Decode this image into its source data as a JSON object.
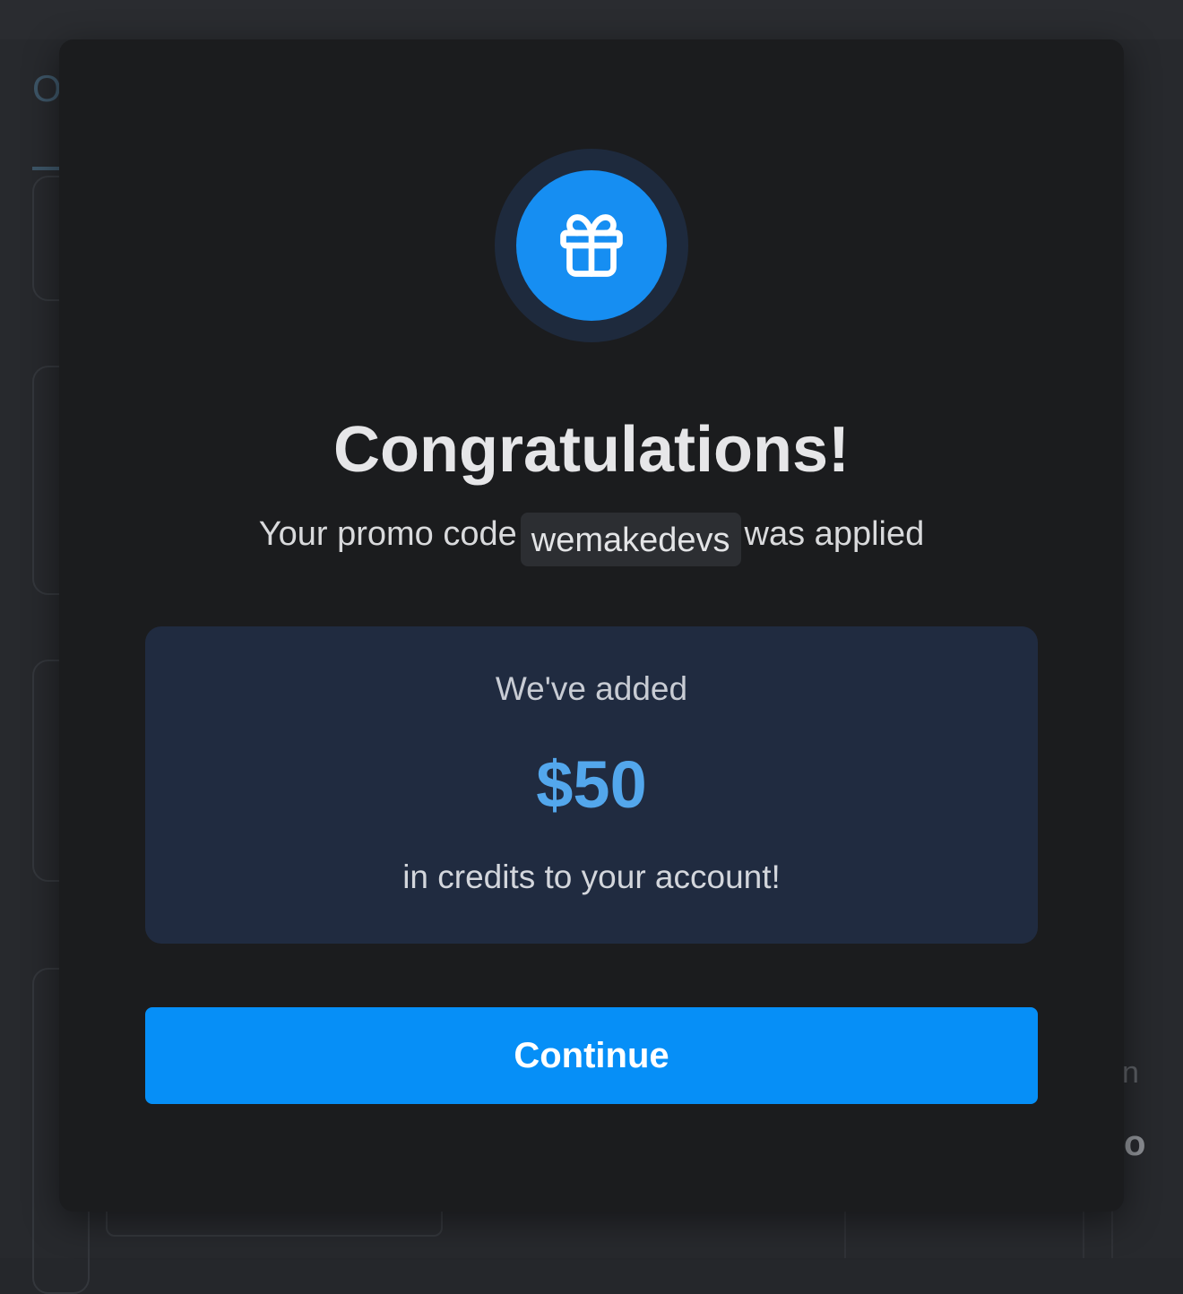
{
  "modal": {
    "title": "Congratulations!",
    "subtitle_before": "Your promo code",
    "promo_code": "wemakedevs",
    "subtitle_after": "was applied",
    "icon": "gift-icon"
  },
  "credit": {
    "pre_text": "We've added",
    "amount": "$50",
    "post_text": "in credits to your account!"
  },
  "actions": {
    "continue_label": "Continue"
  },
  "background": {
    "partial_tab_letter": "O",
    "partial_letter_1": "n",
    "partial_letter_2": "o"
  },
  "colors": {
    "accent": "#068ff7",
    "amount_text": "#53a7ec",
    "modal_bg": "#1b1c1e",
    "credit_panel_bg": "#202b40"
  }
}
